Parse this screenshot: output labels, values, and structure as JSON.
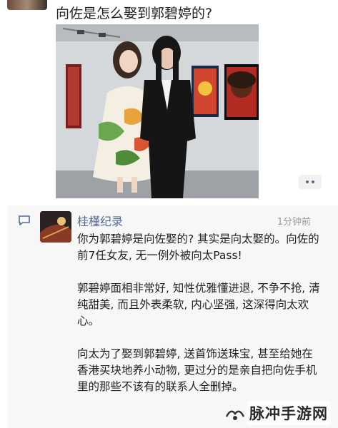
{
  "post": {
    "title": "向佐是怎么娶到郭碧婷的?",
    "photo_description_icon": "photo"
  },
  "comment": {
    "author": "桂槿纪录",
    "time": "1分钟前",
    "paragraph1": "你为郭碧婷是向佐娶的? 其实是向太娶的。向佐的前7任女友, 无一例外被向太Pass!",
    "paragraph2": "郭碧婷面相非常好, 知性优雅懂进退, 不争不抢, 清纯甜美, 而且外表柔软, 内心坚强, 这深得向太欢心。",
    "paragraph3": "向太为了娶到郭碧婷, 送首饰送珠宝, 甚至给她在香港买块地养小动物, 更过分的是亲自把向佐手机里的那些不该有的联系人全删掉。"
  },
  "watermark": {
    "text": "脉冲手游网"
  },
  "colors": {
    "link_name": "#576b95",
    "comment_bg": "#f7f7f7"
  }
}
